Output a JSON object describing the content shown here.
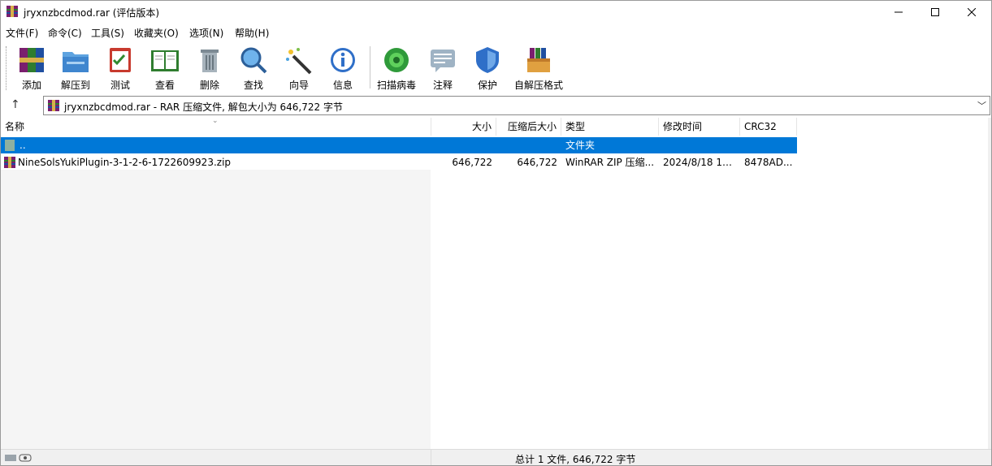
{
  "window": {
    "title": "jryxnzbcdmod.rar (评估版本)"
  },
  "menu": [
    "文件(F)",
    "命令(C)",
    "工具(S)",
    "收藏夹(O)",
    "选项(N)",
    "帮助(H)"
  ],
  "toolbar": [
    "添加",
    "解压到",
    "测试",
    "查看",
    "删除",
    "查找",
    "向导",
    "信息",
    "扫描病毒",
    "注释",
    "保护",
    "自解压格式"
  ],
  "address": {
    "text": "jryxnzbcdmod.rar - RAR 压缩文件, 解包大小为 646,722 字节"
  },
  "columns": [
    "名称",
    "大小",
    "压缩后大小",
    "类型",
    "修改时间",
    "CRC32"
  ],
  "rows": [
    {
      "name": "..",
      "size": "",
      "packed": "",
      "type": "文件夹",
      "modified": "",
      "crc": ""
    },
    {
      "name": "NineSolsYukiPlugin-3-1-2-6-1722609923.zip",
      "size": "646,722",
      "packed": "646,722",
      "type": "WinRAR ZIP 压缩...",
      "modified": "2024/8/18 14...",
      "crc": "8478AD..."
    }
  ],
  "status": {
    "text": "总计 1 文件, 646,722 字节"
  },
  "colors": {
    "selection": "#0078d7"
  }
}
